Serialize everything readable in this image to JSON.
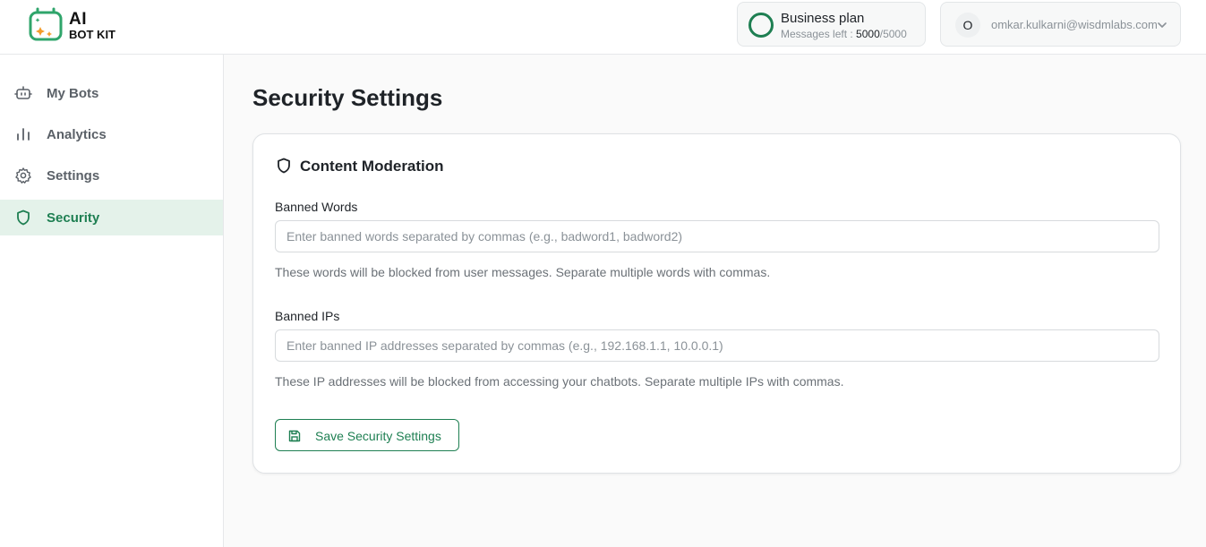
{
  "brand": {
    "line1": "AI",
    "line2": "BOT KIT",
    "accent_color": "#1e7f52",
    "icon": "logo-icon"
  },
  "plan": {
    "name": "Business plan",
    "messages_label": "Messages left : ",
    "messages_used": "5000",
    "messages_total": "/5000"
  },
  "user": {
    "initial": "O",
    "email": "omkar.kulkarni@wisdmlabs.com",
    "menu_icon": "chevron-down-icon"
  },
  "sidebar": {
    "items": [
      {
        "label": "My Bots",
        "icon": "robot-icon"
      },
      {
        "label": "Analytics",
        "icon": "bar-chart-icon"
      },
      {
        "label": "Settings",
        "icon": "gear-icon"
      },
      {
        "label": "Security",
        "icon": "shield-icon",
        "active": true
      }
    ]
  },
  "main": {
    "title": "Security Settings",
    "card": {
      "title": "Content Moderation",
      "icon": "shield-icon",
      "banned_words": {
        "label": "Banned Words",
        "placeholder": "Enter banned words separated by commas (e.g., badword1, badword2)",
        "value": "",
        "help": "These words will be blocked from user messages. Separate multiple words with commas."
      },
      "banned_ips": {
        "label": "Banned IPs",
        "placeholder": "Enter banned IP addresses separated by commas (e.g., 192.168.1.1, 10.0.0.1)",
        "value": "",
        "help": "These IP addresses will be blocked from accessing your chatbots. Separate multiple IPs with commas."
      },
      "save_button": {
        "label": "Save Security Settings",
        "icon": "save-icon"
      }
    }
  }
}
